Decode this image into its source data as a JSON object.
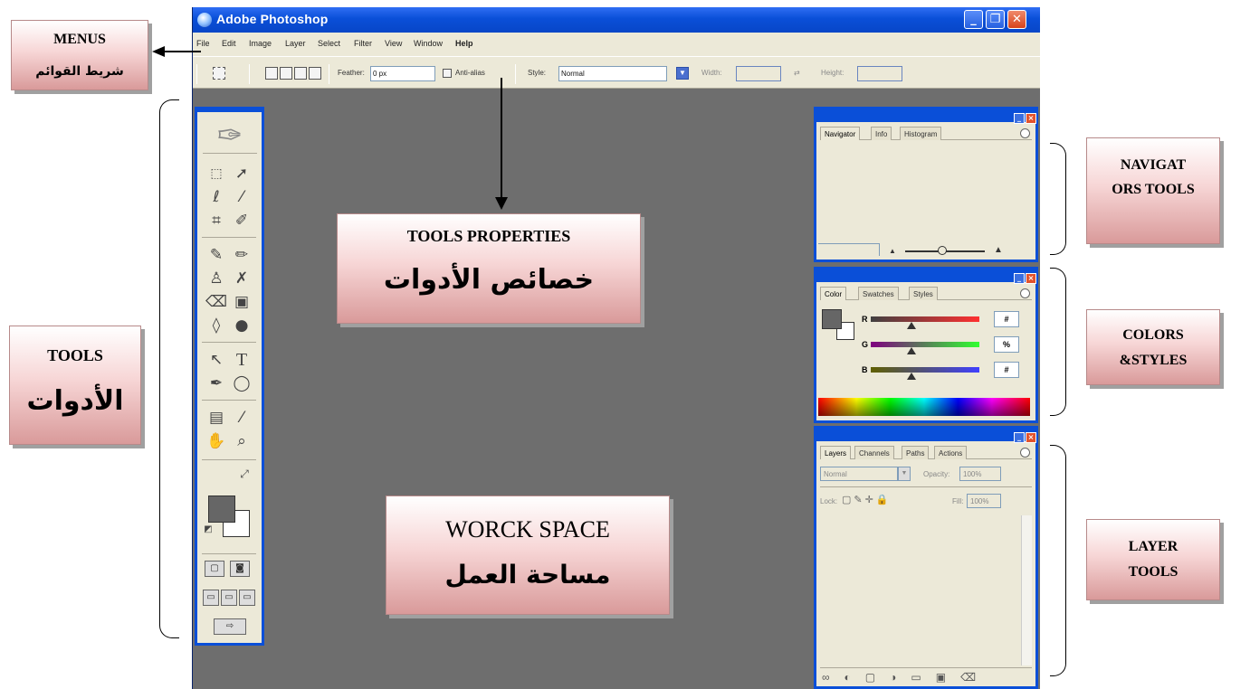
{
  "window": {
    "title": "Adobe Photoshop",
    "minimize": "_",
    "maximize": "❐",
    "close": "✕"
  },
  "menu": [
    "File",
    "Edit",
    "Image",
    "Layer",
    "Select",
    "Filter",
    "View",
    "Window",
    "Help"
  ],
  "options_bar": {
    "feather_label": "Feather:",
    "feather_value": "0 px",
    "antialias_label": "Anti-alias",
    "style_label": "Style:",
    "style_value": "Normal",
    "width_label": "Width:",
    "height_label": "Height:"
  },
  "palettes": {
    "navigator_tabs": [
      "Navigator",
      "Info",
      "Histogram"
    ],
    "color_tabs": [
      "Color",
      "Swatches",
      "Styles"
    ],
    "color_sliders": [
      {
        "label": "R",
        "value": "#"
      },
      {
        "label": "G",
        "value": "%"
      },
      {
        "label": "B",
        "value": "#"
      }
    ],
    "layers_tabs": [
      "Layers",
      "Channels",
      "Paths",
      "Actions"
    ],
    "blend_mode": "Normal",
    "opacity_label": "Opacity:",
    "opacity_value": "100%",
    "lock_label": "Lock:",
    "fill_label": "Fill:",
    "fill_value": "100%"
  },
  "annotations": {
    "menus": {
      "en": "MENUS",
      "ar": "شريط القوائم"
    },
    "tools_properties": {
      "en": "TOOLS PROPERTIES",
      "ar": "خصائص الأدوات"
    },
    "tools": {
      "en": "TOOLS",
      "ar": "الأدوات"
    },
    "workspace": {
      "en": "WORCK SPACE",
      "ar": "مساحة العمل"
    },
    "navigators": {
      "en": "NAVIGAT ORS TOOLS"
    },
    "colors": {
      "en": "COLORS &STYLES"
    },
    "layer": {
      "en": "LAYER TOOLS"
    }
  }
}
